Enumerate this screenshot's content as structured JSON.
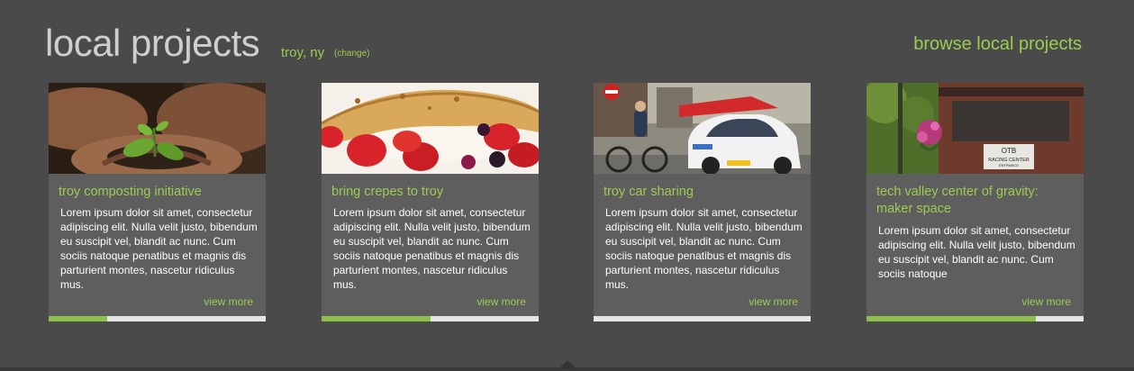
{
  "header": {
    "title": "local projects",
    "location": "troy, ny",
    "change_label": "(change)",
    "browse_label": "browse local projects"
  },
  "colors": {
    "background": "#4a4a4a",
    "card": "#5e5e5e",
    "accent": "#9ccc50",
    "progress_track": "#e6e6e6"
  },
  "cards": [
    {
      "title": "troy composting initiative",
      "description": "Lorem ipsum dolor sit amet, consectetur adipiscing elit. Nulla velit justo, bibendum eu suscipit vel, blandit ac nunc. Cum sociis natoque penatibus et magnis dis parturient montes, nascetur ridiculus mus.",
      "view_more": "view more",
      "progress": 0.27,
      "image": "hands-holding-seedling"
    },
    {
      "title": "bring crepes to troy",
      "description": "Lorem ipsum dolor sit amet, consectetur adipiscing elit. Nulla velit justo, bibendum eu suscipit vel, blandit ac nunc. Cum sociis natoque penatibus et magnis dis parturient montes, nascetur ridiculus mus.",
      "view_more": "view more",
      "progress": 0.5,
      "image": "crepe-with-strawberries"
    },
    {
      "title": "troy car sharing",
      "description": "Lorem ipsum dolor sit amet, consectetur adipiscing elit. Nulla velit justo, bibendum eu suscipit vel, blandit ac nunc. Cum sociis natoque penatibus et magnis dis parturient montes, nascetur ridiculus mus.",
      "view_more": "view more",
      "progress": 0.0,
      "image": "cyclist-and-smart-car"
    },
    {
      "title": "tech valley center of gravity: maker space",
      "description": "Lorem ipsum dolor sit amet, consectetur adipiscing elit. Nulla velit justo, bibendum eu suscipit vel, blandit ac nunc. Cum sociis natoque",
      "view_more": "view more",
      "progress": 0.78,
      "image": "otb-racing-center-storefront",
      "sign_text": [
        "OTB",
        "RACING CENTER",
        "ENTRANCE"
      ]
    }
  ]
}
